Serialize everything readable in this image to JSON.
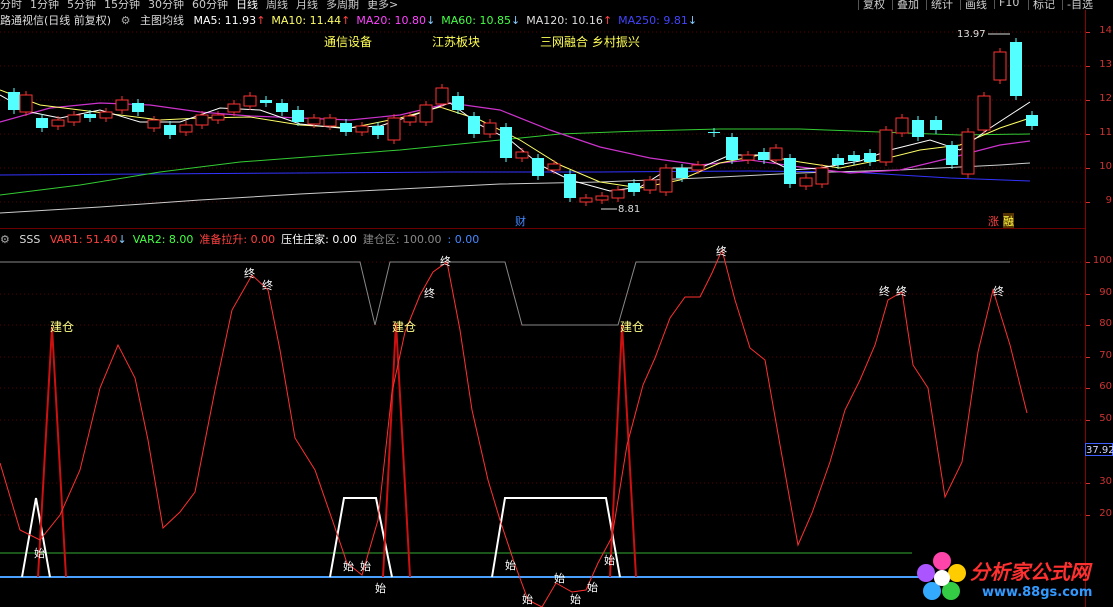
{
  "tabs": [
    "分时",
    "1分钟",
    "5分钟",
    "15分钟",
    "30分钟",
    "60分钟",
    "日线",
    "周线",
    "月线",
    "多周期",
    "更多>"
  ],
  "selected_tab": "日线",
  "right_buttons": [
    "复权",
    "叠加",
    "统计",
    "画线",
    "F10",
    "标记",
    "-自选"
  ],
  "main_legend": {
    "stock": "路通视信(日线 前复权)",
    "indicator": "主图均线",
    "ma": [
      {
        "label": "MA5: 11.93",
        "color": "#ffffff",
        "arrow": "↑"
      },
      {
        "label": "MA10: 11.44",
        "color": "#ffff66",
        "arrow": "↑"
      },
      {
        "label": "MA20: 10.80",
        "color": "#ff44ff",
        "arrow": "↓"
      },
      {
        "label": "MA60: 10.85",
        "color": "#44ff44",
        "arrow": "↓"
      },
      {
        "label": "MA120: 10.16",
        "color": "#dddddd",
        "arrow": "↑"
      },
      {
        "label": "MA250: 9.81",
        "color": "#4444ff",
        "arrow": "↓"
      }
    ]
  },
  "concept_tags": [
    "通信设备",
    "江苏板块",
    "三网融合 乡村振兴"
  ],
  "price_annotations": {
    "high": "13.97",
    "low": "8.81",
    "cai": "财",
    "zhang": "涨",
    "rong": "融"
  },
  "price_axis": [
    "14",
    "13",
    "12",
    "11",
    "10",
    "9"
  ],
  "sub_legend": {
    "name": "SSS",
    "items": [
      {
        "label": "VAR1: 51.40",
        "color": "#ff4040",
        "arrow": "↓"
      },
      {
        "label": "VAR2: 8.00",
        "color": "#44ff44",
        "arrow": ""
      },
      {
        "label": "准备拉升: 0.00",
        "color": "#ff4040",
        "arrow": ""
      },
      {
        "label": "压住庄家: 0.00",
        "color": "#ffffff",
        "arrow": ""
      },
      {
        "label": "建仓区: 100.00",
        "color": "#888888",
        "arrow": ""
      },
      {
        "label": ": 0.00",
        "color": "#4488ff",
        "arrow": ""
      }
    ]
  },
  "sub_axis": [
    "100",
    "90",
    "80",
    "70",
    "60",
    "50",
    "30",
    "20"
  ],
  "sub_current_value": "37.92",
  "signals": {
    "jiancang": "建仓",
    "zhong": "终",
    "shi": "始"
  },
  "watermark": {
    "cn": "分析家公式网",
    "url": "www.88gs.com"
  }
}
